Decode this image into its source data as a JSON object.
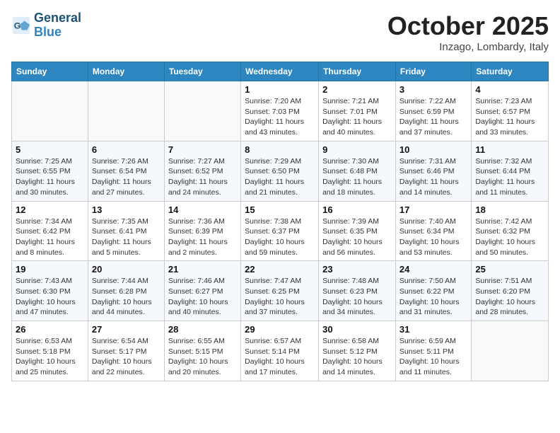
{
  "header": {
    "logo_line1": "General",
    "logo_line2": "Blue",
    "month": "October 2025",
    "location": "Inzago, Lombardy, Italy"
  },
  "weekdays": [
    "Sunday",
    "Monday",
    "Tuesday",
    "Wednesday",
    "Thursday",
    "Friday",
    "Saturday"
  ],
  "weeks": [
    [
      {
        "day": "",
        "info": ""
      },
      {
        "day": "",
        "info": ""
      },
      {
        "day": "",
        "info": ""
      },
      {
        "day": "1",
        "info": "Sunrise: 7:20 AM\nSunset: 7:03 PM\nDaylight: 11 hours and 43 minutes."
      },
      {
        "day": "2",
        "info": "Sunrise: 7:21 AM\nSunset: 7:01 PM\nDaylight: 11 hours and 40 minutes."
      },
      {
        "day": "3",
        "info": "Sunrise: 7:22 AM\nSunset: 6:59 PM\nDaylight: 11 hours and 37 minutes."
      },
      {
        "day": "4",
        "info": "Sunrise: 7:23 AM\nSunset: 6:57 PM\nDaylight: 11 hours and 33 minutes."
      }
    ],
    [
      {
        "day": "5",
        "info": "Sunrise: 7:25 AM\nSunset: 6:55 PM\nDaylight: 11 hours and 30 minutes."
      },
      {
        "day": "6",
        "info": "Sunrise: 7:26 AM\nSunset: 6:54 PM\nDaylight: 11 hours and 27 minutes."
      },
      {
        "day": "7",
        "info": "Sunrise: 7:27 AM\nSunset: 6:52 PM\nDaylight: 11 hours and 24 minutes."
      },
      {
        "day": "8",
        "info": "Sunrise: 7:29 AM\nSunset: 6:50 PM\nDaylight: 11 hours and 21 minutes."
      },
      {
        "day": "9",
        "info": "Sunrise: 7:30 AM\nSunset: 6:48 PM\nDaylight: 11 hours and 18 minutes."
      },
      {
        "day": "10",
        "info": "Sunrise: 7:31 AM\nSunset: 6:46 PM\nDaylight: 11 hours and 14 minutes."
      },
      {
        "day": "11",
        "info": "Sunrise: 7:32 AM\nSunset: 6:44 PM\nDaylight: 11 hours and 11 minutes."
      }
    ],
    [
      {
        "day": "12",
        "info": "Sunrise: 7:34 AM\nSunset: 6:42 PM\nDaylight: 11 hours and 8 minutes."
      },
      {
        "day": "13",
        "info": "Sunrise: 7:35 AM\nSunset: 6:41 PM\nDaylight: 11 hours and 5 minutes."
      },
      {
        "day": "14",
        "info": "Sunrise: 7:36 AM\nSunset: 6:39 PM\nDaylight: 11 hours and 2 minutes."
      },
      {
        "day": "15",
        "info": "Sunrise: 7:38 AM\nSunset: 6:37 PM\nDaylight: 10 hours and 59 minutes."
      },
      {
        "day": "16",
        "info": "Sunrise: 7:39 AM\nSunset: 6:35 PM\nDaylight: 10 hours and 56 minutes."
      },
      {
        "day": "17",
        "info": "Sunrise: 7:40 AM\nSunset: 6:34 PM\nDaylight: 10 hours and 53 minutes."
      },
      {
        "day": "18",
        "info": "Sunrise: 7:42 AM\nSunset: 6:32 PM\nDaylight: 10 hours and 50 minutes."
      }
    ],
    [
      {
        "day": "19",
        "info": "Sunrise: 7:43 AM\nSunset: 6:30 PM\nDaylight: 10 hours and 47 minutes."
      },
      {
        "day": "20",
        "info": "Sunrise: 7:44 AM\nSunset: 6:28 PM\nDaylight: 10 hours and 44 minutes."
      },
      {
        "day": "21",
        "info": "Sunrise: 7:46 AM\nSunset: 6:27 PM\nDaylight: 10 hours and 40 minutes."
      },
      {
        "day": "22",
        "info": "Sunrise: 7:47 AM\nSunset: 6:25 PM\nDaylight: 10 hours and 37 minutes."
      },
      {
        "day": "23",
        "info": "Sunrise: 7:48 AM\nSunset: 6:23 PM\nDaylight: 10 hours and 34 minutes."
      },
      {
        "day": "24",
        "info": "Sunrise: 7:50 AM\nSunset: 6:22 PM\nDaylight: 10 hours and 31 minutes."
      },
      {
        "day": "25",
        "info": "Sunrise: 7:51 AM\nSunset: 6:20 PM\nDaylight: 10 hours and 28 minutes."
      }
    ],
    [
      {
        "day": "26",
        "info": "Sunrise: 6:53 AM\nSunset: 5:18 PM\nDaylight: 10 hours and 25 minutes."
      },
      {
        "day": "27",
        "info": "Sunrise: 6:54 AM\nSunset: 5:17 PM\nDaylight: 10 hours and 22 minutes."
      },
      {
        "day": "28",
        "info": "Sunrise: 6:55 AM\nSunset: 5:15 PM\nDaylight: 10 hours and 20 minutes."
      },
      {
        "day": "29",
        "info": "Sunrise: 6:57 AM\nSunset: 5:14 PM\nDaylight: 10 hours and 17 minutes."
      },
      {
        "day": "30",
        "info": "Sunrise: 6:58 AM\nSunset: 5:12 PM\nDaylight: 10 hours and 14 minutes."
      },
      {
        "day": "31",
        "info": "Sunrise: 6:59 AM\nSunset: 5:11 PM\nDaylight: 10 hours and 11 minutes."
      },
      {
        "day": "",
        "info": ""
      }
    ]
  ]
}
